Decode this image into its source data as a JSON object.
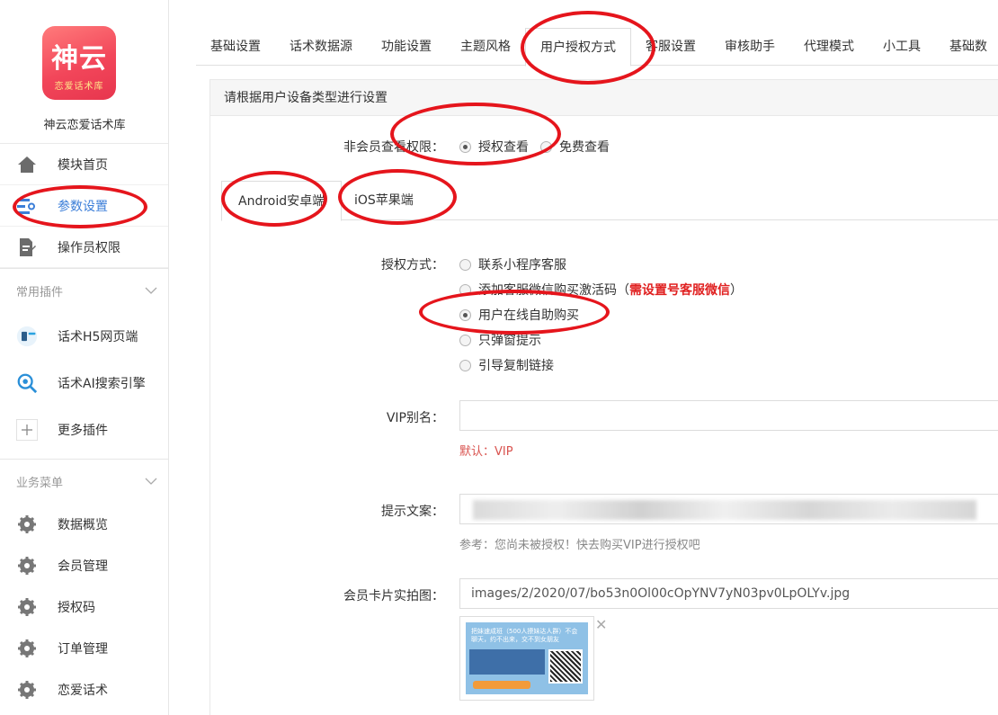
{
  "app": {
    "logo_main": "神云",
    "logo_sub": "恋爱话术库",
    "site_name": "神云恋爱话术库"
  },
  "sidebar": {
    "top_items": [
      {
        "label": "模块首页",
        "icon": "home-icon"
      },
      {
        "label": "参数设置",
        "icon": "settings-list-icon",
        "active": true
      },
      {
        "label": "操作员权限",
        "icon": "document-edit-icon"
      }
    ],
    "plugins_section": "常用插件",
    "plugins": [
      {
        "label": "话术H5网页端",
        "icon": "h5-plugin-icon"
      },
      {
        "label": "话术AI搜索引擎",
        "icon": "ai-search-icon"
      },
      {
        "label": "更多插件",
        "icon": "plus-icon"
      }
    ],
    "business_section": "业务菜单",
    "business": [
      {
        "label": "数据概览",
        "icon": "gear-icon"
      },
      {
        "label": "会员管理",
        "icon": "gear-icon"
      },
      {
        "label": "授权码",
        "icon": "gear-icon"
      },
      {
        "label": "订单管理",
        "icon": "gear-icon"
      },
      {
        "label": "恋爱话术",
        "icon": "gear-icon"
      }
    ]
  },
  "tabs": [
    "基础设置",
    "话术数据源",
    "功能设置",
    "主题风格",
    "用户授权方式",
    "客服设置",
    "审核助手",
    "代理模式",
    "小工具",
    "基础数"
  ],
  "active_tab": "用户授权方式",
  "panel": {
    "header": "请根据用户设备类型进行设置",
    "non_member_label": "非会员查看权限：",
    "non_member_options": [
      {
        "label": "授权查看",
        "checked": true
      },
      {
        "label": "免费查看",
        "checked": false
      }
    ],
    "device_tabs": [
      "Android安卓端",
      "iOS苹果端"
    ],
    "auth_label": "授权方式：",
    "auth_options": [
      {
        "label": "联系小程序客服",
        "checked": false
      },
      {
        "label": "添加客服微信购买激活码（",
        "warn": "需设置号客服微信",
        "tail": "）",
        "checked": false
      },
      {
        "label": "用户在线自助购买",
        "checked": true
      },
      {
        "label": "只弹窗提示",
        "checked": false
      },
      {
        "label": "引导复制链接",
        "checked": false
      }
    ],
    "vip_label": "VIP别名：",
    "vip_value": "",
    "vip_hint": "默认：VIP",
    "tip_label": "提示文案：",
    "tip_hint": "参考：您尚未被授权！快去购买VIP进行授权吧",
    "card_label": "会员卡片实拍图：",
    "card_value": "images/2/2020/07/bo53n0Ol00cOpYNV7yN03pv0LpOLYv.jpg",
    "card_thumb_title": "把妹速成班（500人撩妹达人群）不会聊天，约不出来，交不到女朋友",
    "remove_icon": "close-icon"
  }
}
